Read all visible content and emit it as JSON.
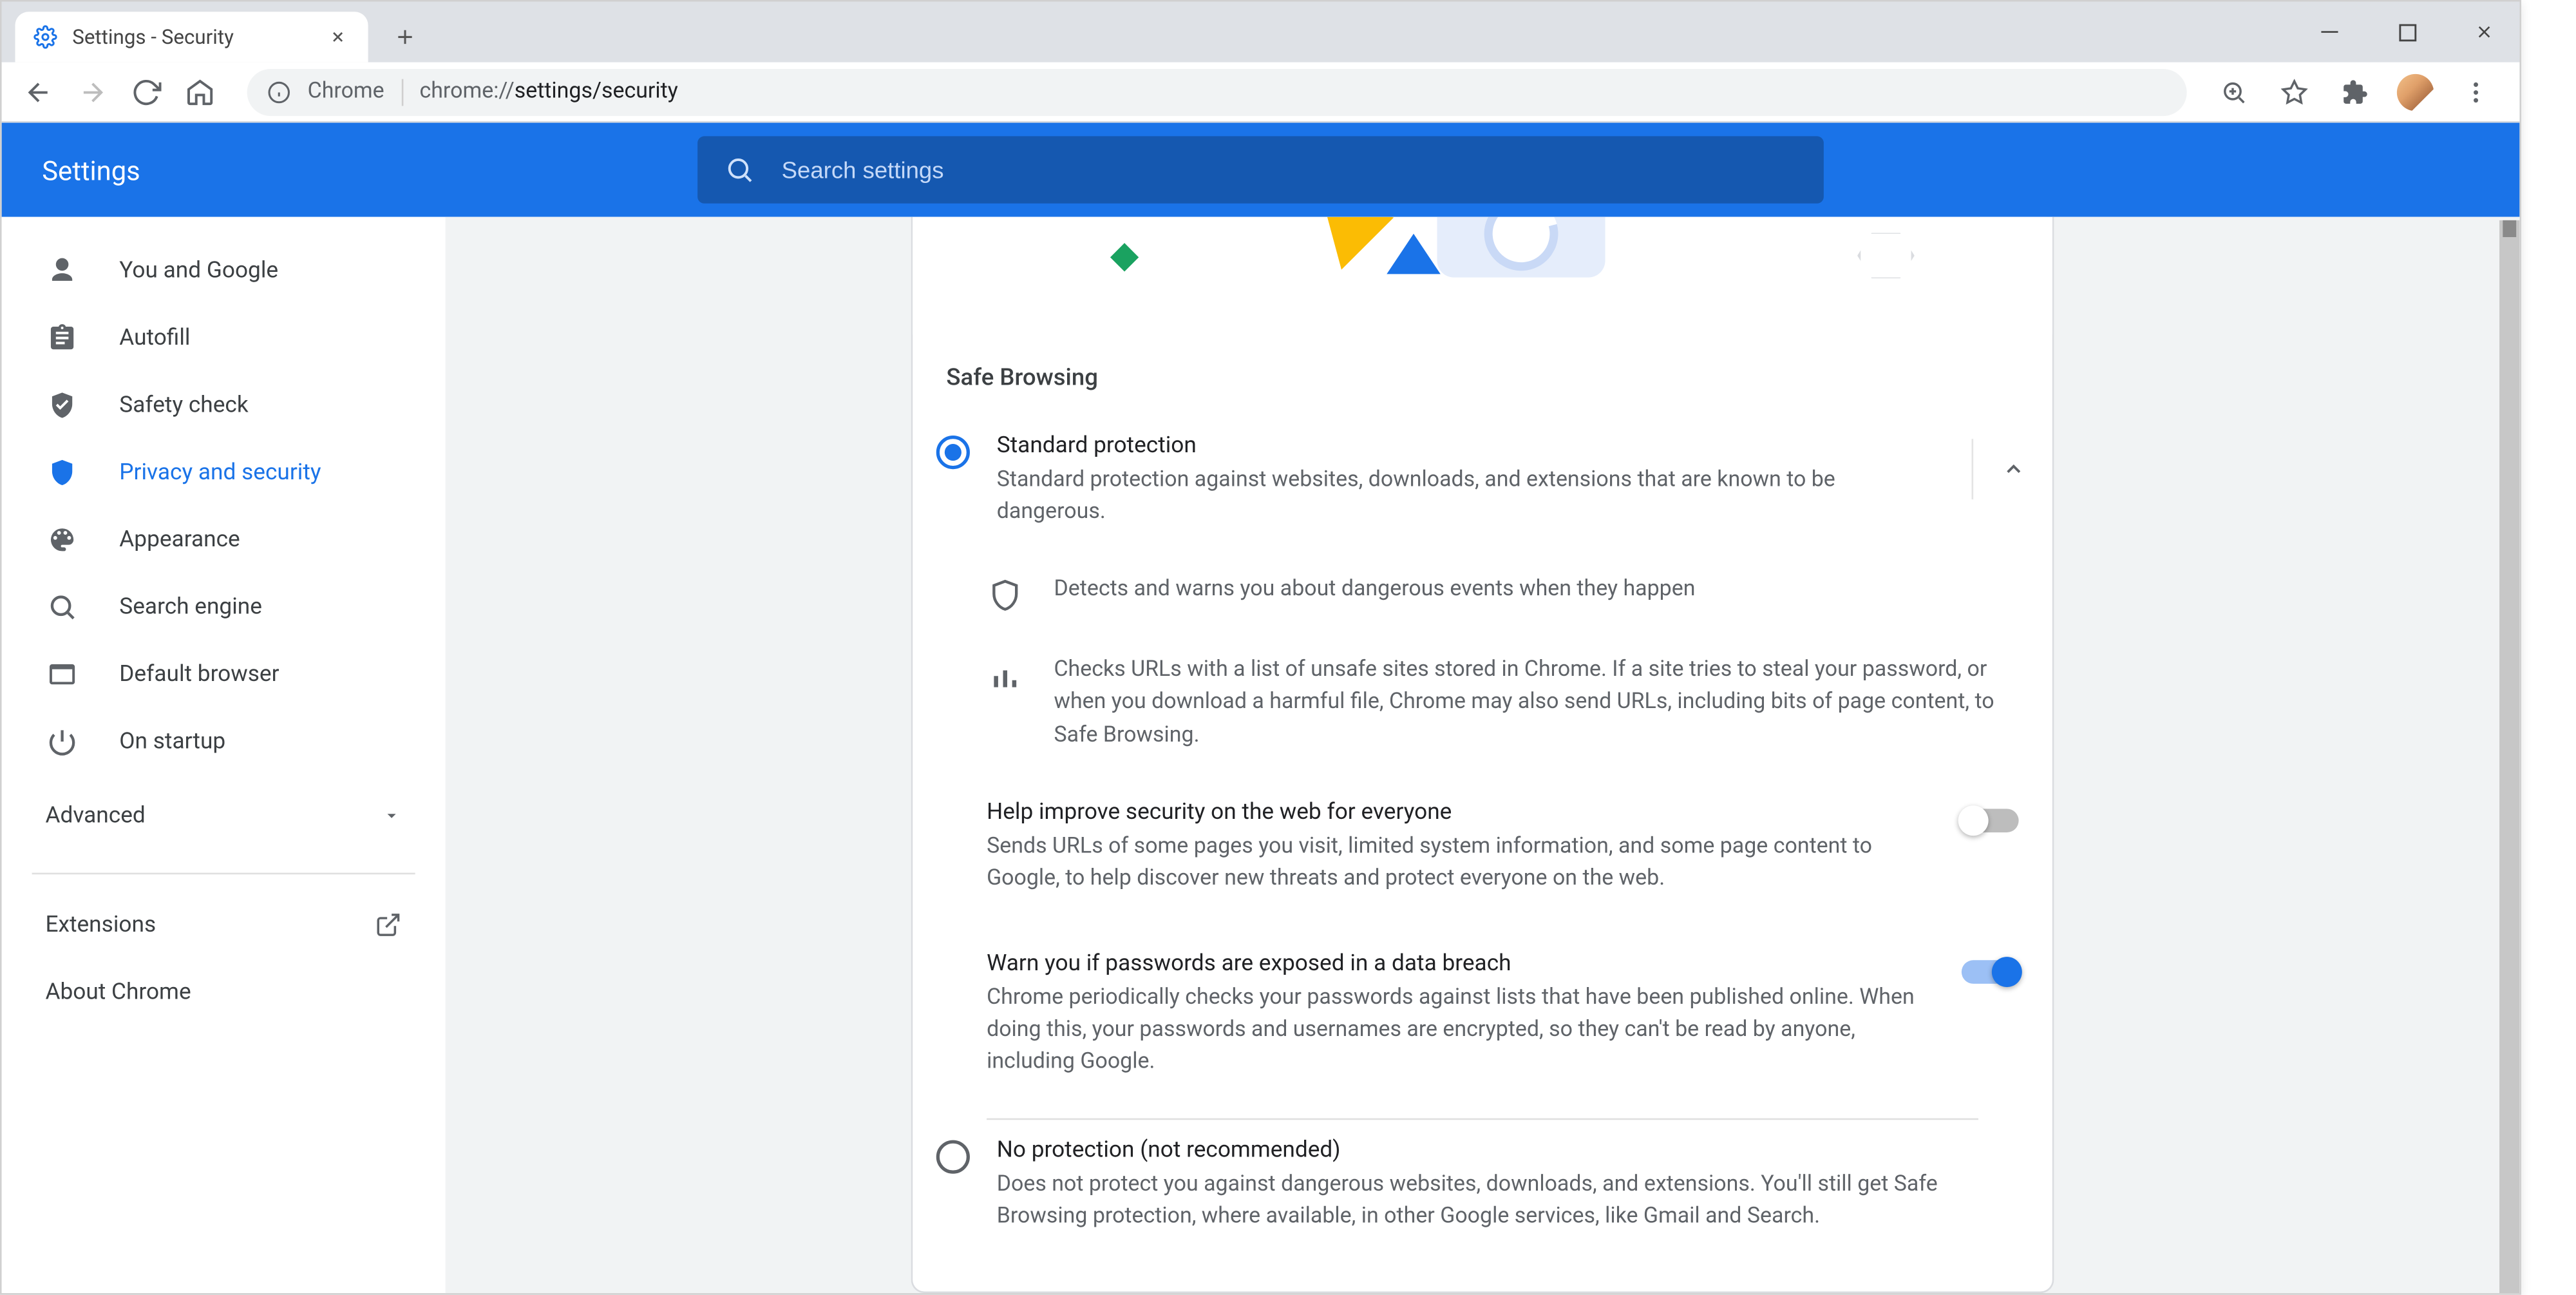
{
  "window": {
    "tab_title": "Settings - Security",
    "omnibox_origin": "Chrome",
    "omnibox_scheme": "chrome://",
    "omnibox_path": "settings/security"
  },
  "header": {
    "app_title": "Settings",
    "search_placeholder": "Search settings"
  },
  "sidebar": {
    "items": [
      {
        "label": "You and Google"
      },
      {
        "label": "Autofill"
      },
      {
        "label": "Safety check"
      },
      {
        "label": "Privacy and security"
      },
      {
        "label": "Appearance"
      },
      {
        "label": "Search engine"
      },
      {
        "label": "Default browser"
      },
      {
        "label": "On startup"
      }
    ],
    "advanced_label": "Advanced",
    "extensions_label": "Extensions",
    "about_label": "About Chrome"
  },
  "main": {
    "section_heading": "Safe Browsing",
    "option_standard": {
      "title": "Standard protection",
      "desc": "Standard protection against websites, downloads, and extensions that are known to be dangerous.",
      "detail1": "Detects and warns you about dangerous events when they happen",
      "detail2": "Checks URLs with a list of unsafe sites stored in Chrome. If a site tries to steal your password, or when you download a harmful file, Chrome may also send URLs, including bits of page content, to Safe Browsing."
    },
    "toggle_help_improve": {
      "title": "Help improve security on the web for everyone",
      "desc": "Sends URLs of some pages you visit, limited system information, and some page content to Google, to help discover new threats and protect everyone on the web."
    },
    "toggle_breach": {
      "title": "Warn you if passwords are exposed in a data breach",
      "desc": "Chrome periodically checks your passwords against lists that have been published online. When doing this, your passwords and usernames are encrypted, so they can't be read by anyone, including Google."
    },
    "option_none": {
      "title": "No protection (not recommended)",
      "desc": "Does not protect you against dangerous websites, downloads, and extensions. You'll still get Safe Browsing protection, where available, in other Google services, like Gmail and Search."
    }
  }
}
